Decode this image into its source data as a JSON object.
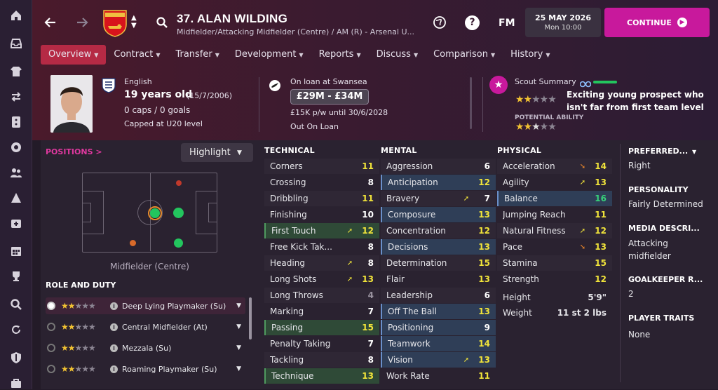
{
  "sidebar": {
    "icons": [
      "home-icon",
      "inbox-icon",
      "kit-icon",
      "transfer-icon",
      "tactics-icon",
      "ball-icon",
      "staff-icon",
      "training-icon",
      "medical-icon",
      "calendar-icon",
      "trophy-icon",
      "search-icon",
      "refresh-icon",
      "shield-icon",
      "briefcase-icon"
    ]
  },
  "player": {
    "title": "37. ALAN WILDING",
    "subtitle": "Midfielder/Attacking Midfielder (Centre) / AM (R) - Arsenal U...",
    "nationality": "English",
    "age": "19 years old",
    "dob": "(15/7/2006)",
    "caps": "0 caps / 0 goals",
    "capped_level": "Capped at U20 level"
  },
  "loan": {
    "status": "On loan at Swansea",
    "value": "£29M - £34M",
    "wage": "£15K p/w until 30/6/2028",
    "contract": "Out On Loan"
  },
  "scout": {
    "label": "Scout Summary",
    "summary": "Exciting young prospect who isn't far from first team level",
    "potential_label": "POTENTIAL ABILITY",
    "current_stars": 2,
    "potential_stars": 2.5
  },
  "topbar": {
    "fm": "FM",
    "date": "25 MAY 2026",
    "time": "Mon 10:00",
    "continue": "CONTINUE",
    "help": "?"
  },
  "tabs": [
    {
      "label": "Overview"
    },
    {
      "label": "Contract"
    },
    {
      "label": "Transfer"
    },
    {
      "label": "Development"
    },
    {
      "label": "Reports"
    },
    {
      "label": "Discuss"
    },
    {
      "label": "Comparison"
    },
    {
      "label": "History"
    }
  ],
  "positions": {
    "label": "POSITIONS",
    "chevron": ">",
    "highlight": "Highlight",
    "pitch_caption": "Midfielder (Centre)",
    "role_duty_label": "ROLE AND DUTY"
  },
  "roles": [
    {
      "name": "Deep Lying Playmaker (Su)",
      "stars": 2
    },
    {
      "name": "Central Midfielder (At)",
      "stars": 2
    },
    {
      "name": "Mezzala (Su)",
      "stars": 2
    },
    {
      "name": "Roaming Playmaker (Su)",
      "stars": 2
    }
  ],
  "technical": {
    "label": "TECHNICAL",
    "items": [
      {
        "name": "Corners",
        "value": "11",
        "arrow": "",
        "hl": false
      },
      {
        "name": "Crossing",
        "value": "8",
        "arrow": "",
        "hl": false
      },
      {
        "name": "Dribbling",
        "value": "11",
        "arrow": "",
        "hl": false
      },
      {
        "name": "Finishing",
        "value": "10",
        "arrow": "",
        "hl": false
      },
      {
        "name": "First Touch",
        "value": "12",
        "arrow": "up",
        "hl": true
      },
      {
        "name": "Free Kick Tak...",
        "value": "8",
        "arrow": "",
        "hl": false
      },
      {
        "name": "Heading",
        "value": "8",
        "arrow": "up",
        "hl": false
      },
      {
        "name": "Long Shots",
        "value": "13",
        "arrow": "up",
        "hl": false
      },
      {
        "name": "Long Throws",
        "value": "4",
        "arrow": "",
        "hl": false
      },
      {
        "name": "Marking",
        "value": "7",
        "arrow": "",
        "hl": false
      },
      {
        "name": "Passing",
        "value": "15",
        "arrow": "",
        "hl": true
      },
      {
        "name": "Penalty Taking",
        "value": "7",
        "arrow": "",
        "hl": false
      },
      {
        "name": "Tackling",
        "value": "8",
        "arrow": "",
        "hl": false
      },
      {
        "name": "Technique",
        "value": "13",
        "arrow": "",
        "hl": true
      }
    ]
  },
  "mental": {
    "label": "MENTAL",
    "items": [
      {
        "name": "Aggression",
        "value": "6",
        "arrow": "",
        "hl": false
      },
      {
        "name": "Anticipation",
        "value": "12",
        "arrow": "",
        "hl": true
      },
      {
        "name": "Bravery",
        "value": "7",
        "arrow": "up",
        "hl": false
      },
      {
        "name": "Composure",
        "value": "13",
        "arrow": "",
        "hl": true
      },
      {
        "name": "Concentration",
        "value": "12",
        "arrow": "",
        "hl": false
      },
      {
        "name": "Decisions",
        "value": "13",
        "arrow": "",
        "hl": true
      },
      {
        "name": "Determination",
        "value": "15",
        "arrow": "",
        "hl": false
      },
      {
        "name": "Flair",
        "value": "13",
        "arrow": "",
        "hl": false
      },
      {
        "name": "Leadership",
        "value": "6",
        "arrow": "",
        "hl": false
      },
      {
        "name": "Off The Ball",
        "value": "13",
        "arrow": "",
        "hl": true
      },
      {
        "name": "Positioning",
        "value": "9",
        "arrow": "",
        "hl": true
      },
      {
        "name": "Teamwork",
        "value": "14",
        "arrow": "",
        "hl": true
      },
      {
        "name": "Vision",
        "value": "13",
        "arrow": "up",
        "hl": true
      },
      {
        "name": "Work Rate",
        "value": "11",
        "arrow": "",
        "hl": false
      }
    ]
  },
  "physical": {
    "label": "PHYSICAL",
    "items": [
      {
        "name": "Acceleration",
        "value": "14",
        "arrow": "down",
        "hl": false
      },
      {
        "name": "Agility",
        "value": "13",
        "arrow": "up",
        "hl": false
      },
      {
        "name": "Balance",
        "value": "16",
        "arrow": "",
        "hl": true
      },
      {
        "name": "Jumping Reach",
        "value": "11",
        "arrow": "",
        "hl": false
      },
      {
        "name": "Natural Fitness",
        "value": "12",
        "arrow": "up",
        "hl": false
      },
      {
        "name": "Pace",
        "value": "13",
        "arrow": "down",
        "hl": false
      },
      {
        "name": "Stamina",
        "value": "15",
        "arrow": "",
        "hl": false
      },
      {
        "name": "Strength",
        "value": "12",
        "arrow": "",
        "hl": false
      }
    ],
    "height_label": "Height",
    "height": "5'9\"",
    "weight_label": "Weight",
    "weight": "11 st 2 lbs"
  },
  "side": {
    "preferred_label": "PREFERRED...",
    "preferred": "Right",
    "personality_label": "PERSONALITY",
    "personality": "Fairly Determined",
    "media_label": "MEDIA DESCRI...",
    "media": "Attacking midfielder",
    "gk_label": "GOALKEEPER R...",
    "gk": "2",
    "traits_label": "PLAYER TRAITS",
    "traits": "None"
  },
  "colors": {
    "accent": "#c8199c",
    "tab_active": "#b52a45",
    "star": "#f1c232",
    "green": "#23c55e",
    "hl_green": "#2f4a37",
    "hl_blue": "#2f3e57"
  }
}
